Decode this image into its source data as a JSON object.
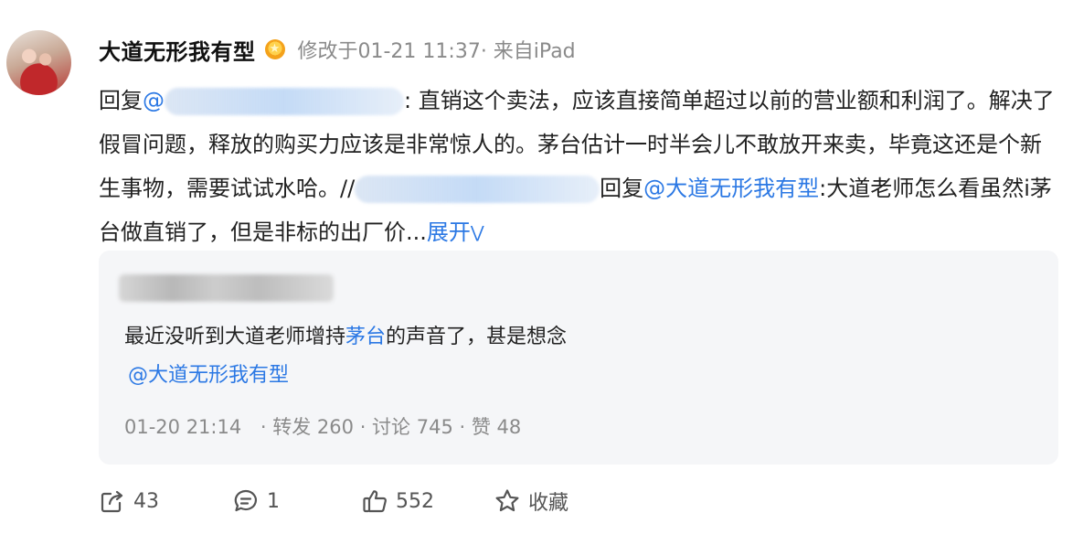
{
  "post": {
    "author": "大道无形我有型",
    "meta": "修改于01-21 11:37· 来自iPad",
    "body": {
      "reply_prefix": "回复",
      "mention_start": "@",
      "text1": ": 直销这个卖法，应该直接简单超过以前的营业额和利润了。解决了假冒问题，释放的购买力应该是非常惊人的。茅台估计一时半会儿不敢放开来卖，毕竟这还是个新生事物，需要试试水哈。//",
      "reply2": "回复",
      "mention2": "@大道无形我有型",
      "text2": ":大道老师怎么看虽然i茅台做直销了，但是非标的出厂价...",
      "expand": "展开"
    }
  },
  "quote": {
    "text_before": "最近没听到大道老师增持",
    "topic_link": "茅台",
    "text_after": "的声音了，甚是想念",
    "mention": "@大道无形我有型",
    "time": "01-20 21:14",
    "reposts": "· 转发 260",
    "comments": "· 讨论 745",
    "likes": "· 赞 48"
  },
  "actions": {
    "share_count": "43",
    "comment_count": "1",
    "like_count": "552",
    "favorite_label": "收藏"
  },
  "icons": [
    "share-icon",
    "comment-icon",
    "like-icon",
    "star-icon",
    "vip-badge-icon"
  ],
  "colors": {
    "link": "#2b78e4",
    "meta": "#8a8a8a",
    "quote_bg": "#f5f6f8"
  }
}
